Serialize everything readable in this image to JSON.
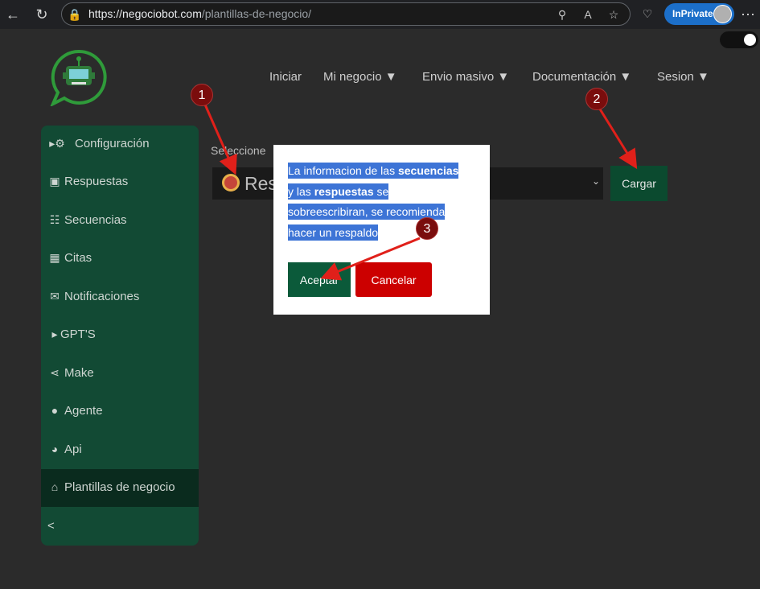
{
  "browser": {
    "url_host": "https://negociobot.com",
    "url_path": "/plantillas-de-negocio/",
    "inprivate_label": "InPrivate"
  },
  "nav": {
    "items": [
      "Iniciar",
      "Mi negocio ▼",
      "Envio masivo ▼",
      "Documentación ▼",
      "Sesion ▼"
    ]
  },
  "sidebar": {
    "items": [
      {
        "icon": "gear-icon",
        "label": "Configuración"
      },
      {
        "icon": "robot-icon",
        "label": "Respuestas"
      },
      {
        "icon": "sitemap-icon",
        "label": "Secuencias"
      },
      {
        "icon": "calendar-icon",
        "label": "Citas"
      },
      {
        "icon": "megaphone-icon",
        "label": "Notificaciones"
      },
      {
        "icon": "caret-right-icon",
        "label": "GPT'S"
      },
      {
        "icon": "share-nodes-icon",
        "label": "Make"
      },
      {
        "icon": "user-icon",
        "label": "Agente"
      },
      {
        "icon": "globe-icon",
        "label": "Api"
      },
      {
        "icon": "store-icon",
        "label": "Plantillas de negocio"
      }
    ],
    "collapse_label": "<"
  },
  "main": {
    "select_label": "Seleccione",
    "select_value": "Res",
    "load_button": "Cargar"
  },
  "modal": {
    "line1_pre": "La informacion de las ",
    "line1_bold": "secuencias",
    "line2_pre": "y las ",
    "line2_bold": "respuestas",
    "line2_post": " se",
    "line3": "sobreescribiran, se recomienda",
    "line4": "hacer un respaldo",
    "accept": "Aceptar",
    "cancel": "Cancelar"
  },
  "annotations": {
    "badges": [
      "1",
      "2",
      "3"
    ],
    "color": "#e0201a"
  }
}
